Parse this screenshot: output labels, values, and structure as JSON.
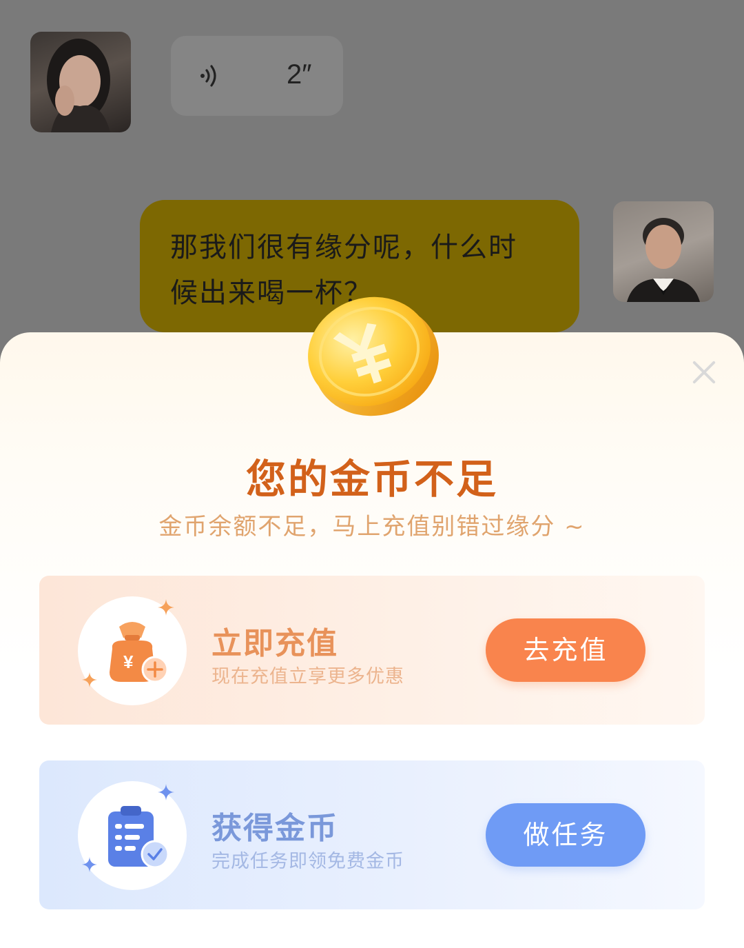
{
  "chat": {
    "voice_message": {
      "duration": "2″"
    },
    "text_message": {
      "line1": "那我们很有缘分呢，什么时",
      "line2": "候出来喝一杯？"
    }
  },
  "popup": {
    "title": "您的金币不足",
    "subtitle": "金币余额不足，马上充值别错过缘分 ~",
    "coin_icon": "yuan-coin-icon",
    "cards": [
      {
        "title": "立即充值",
        "description": "现在充值立享更多优惠",
        "button_label": "去充值",
        "icon": "money-bag-plus-icon",
        "accent": "#f9844d"
      },
      {
        "title": "获得金币",
        "description": "完成任务即领免费金币",
        "button_label": "做任务",
        "icon": "task-clipboard-check-icon",
        "accent": "#6f9bf5"
      }
    ]
  },
  "colors": {
    "title": "#d2611a",
    "subtitle": "#e0a46e",
    "overlay": "#7a7a7a",
    "text_bubble": "#7d6802"
  }
}
